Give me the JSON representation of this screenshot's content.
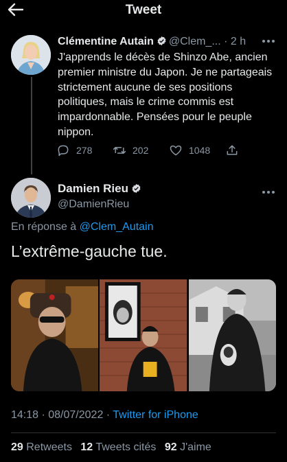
{
  "header": {
    "title": "Tweet",
    "back_icon": "arrow-left-icon"
  },
  "parent_tweet": {
    "author_name": "Clémentine Autain",
    "handle_time": "@Clem_... · 2 h",
    "text": "J'apprends le décès de Shinzo Abe, ancien premier ministre du Japon. Je ne partageais strictement aucune de ses positions politiques, mais le crime commis est impardonnable. Pensées pour le peuple nippon.",
    "replies": "278",
    "retweets": "202",
    "likes": "1048"
  },
  "main_tweet": {
    "author_name": "Damien Rieu",
    "handle": "@DamienRieu",
    "reply_prefix": "En réponse à",
    "reply_handle": "@Clem_Autain",
    "text": "L’extrême-gauche tue.",
    "time": "14:18 · 08/07/2022 · ",
    "source": "Twitter for iPhone",
    "stats": {
      "retweets_count": "29",
      "retweets_label": "Retweets",
      "quotes_count": "12",
      "quotes_label": "Tweets cités",
      "likes_count": "92",
      "likes_label": "J'aime"
    }
  },
  "colors": {
    "background": "#000000",
    "text": "#e7e9ea",
    "muted": "#8b98a5",
    "link": "#1d9bf0",
    "divider": "#2f3336"
  }
}
